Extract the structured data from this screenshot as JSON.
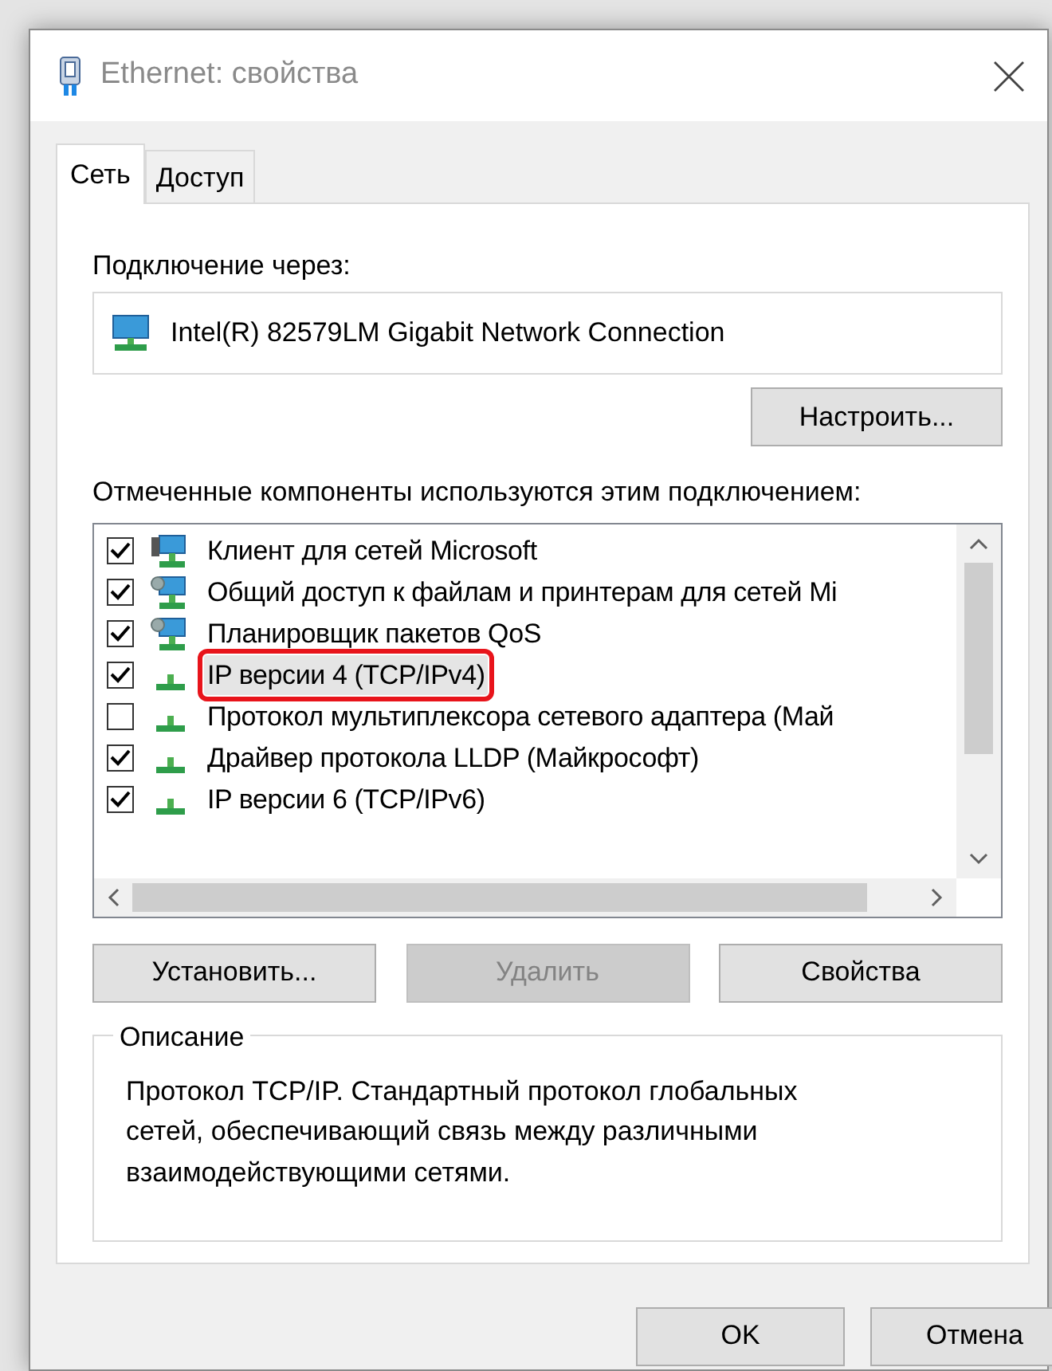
{
  "window": {
    "title": "Ethernet: свойства"
  },
  "tabs": [
    {
      "label": "Сеть",
      "selected": true
    },
    {
      "label": "Доступ",
      "selected": false
    }
  ],
  "connect_label": "Подключение через:",
  "adapter": {
    "name": "Intel(R) 82579LM Gigabit Network Connection"
  },
  "configure_button": "Настроить...",
  "components_label": "Отмеченные компоненты используются этим подключением:",
  "components": [
    {
      "label": "Клиент для сетей Microsoft",
      "checked": true,
      "kind": "client",
      "selected": false,
      "highlighted": false
    },
    {
      "label": "Общий доступ к файлам и принтерам для сетей Mi",
      "checked": true,
      "kind": "service",
      "selected": false,
      "highlighted": false
    },
    {
      "label": "Планировщик пакетов QoS",
      "checked": true,
      "kind": "service",
      "selected": false,
      "highlighted": false
    },
    {
      "label": "IP версии 4 (TCP/IPv4)",
      "checked": true,
      "kind": "protocol",
      "selected": true,
      "highlighted": true
    },
    {
      "label": "Протокол мультиплексора сетевого адаптера (Май",
      "checked": false,
      "kind": "protocol",
      "selected": false,
      "highlighted": false
    },
    {
      "label": "Драйвер протокола LLDP (Майкрософт)",
      "checked": true,
      "kind": "protocol",
      "selected": false,
      "highlighted": false
    },
    {
      "label": "IP версии 6 (TCP/IPv6)",
      "checked": true,
      "kind": "protocol",
      "selected": false,
      "highlighted": false
    }
  ],
  "action_buttons": [
    {
      "label": "Установить...",
      "disabled": false
    },
    {
      "label": "Удалить",
      "disabled": true
    },
    {
      "label": "Свойства",
      "disabled": false
    }
  ],
  "description": {
    "title": "Описание",
    "text": "Протокол TCP/IP. Стандартный протокол глобальных сетей, обеспечивающий связь между различными взаимодействующими сетями."
  },
  "dialog_buttons": [
    "OK",
    "Отмена"
  ]
}
